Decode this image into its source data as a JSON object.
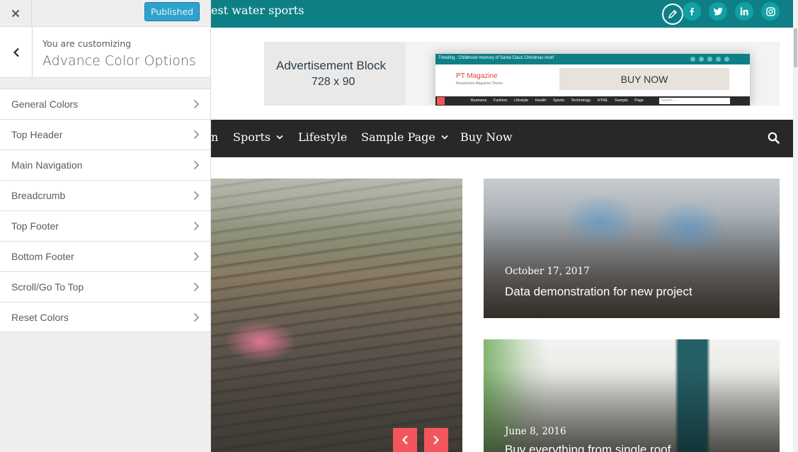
{
  "customizer": {
    "publish_label": "Published",
    "section_subtitle": "You are customizing",
    "section_title": "Advance Color Options",
    "menu": [
      {
        "label": "General Colors"
      },
      {
        "label": "Top Header"
      },
      {
        "label": "Main Navigation"
      },
      {
        "label": "Breadcrumb"
      },
      {
        "label": "Top Footer"
      },
      {
        "label": "Bottom Footer"
      },
      {
        "label": "Scroll/Go To Top"
      },
      {
        "label": "Reset Colors"
      }
    ]
  },
  "site": {
    "top_header": {
      "ticker_text": "est water sports",
      "social_icons": [
        "facebook-icon",
        "twitter-icon",
        "linkedin-icon",
        "instagram-icon"
      ]
    },
    "ad": {
      "title": "Advertisement Block",
      "size": "728 x 90",
      "mini_trending": "Trending :   Childhood memory of Santa Claus Christmas motif",
      "mini_brand": "PT Magazine",
      "mini_tagline": "Responsive Magazine Theme",
      "mini_buy": "BUY NOW",
      "mini_nav": "Business Fashion Lifestyle Health Sports Technology HTML Sample Page",
      "mini_search": "Search ..."
    },
    "nav": {
      "partial_item": "n",
      "items": [
        {
          "label": "Sports",
          "dropdown": true
        },
        {
          "label": "Lifestyle",
          "dropdown": false
        },
        {
          "label": "Sample Page",
          "dropdown": true
        },
        {
          "label": "Buy Now",
          "dropdown": false
        }
      ]
    },
    "posts": [
      {
        "date": "October 17, 2017",
        "title": "Data demonstration for new project"
      },
      {
        "date": "June 8, 2016",
        "title": "Buy everything from single roof"
      }
    ]
  },
  "colors": {
    "accent_teal": "#0f7f86",
    "nav_dark": "#282828",
    "slider_red": "#f2565c",
    "publish_blue": "#2ea2cc"
  }
}
